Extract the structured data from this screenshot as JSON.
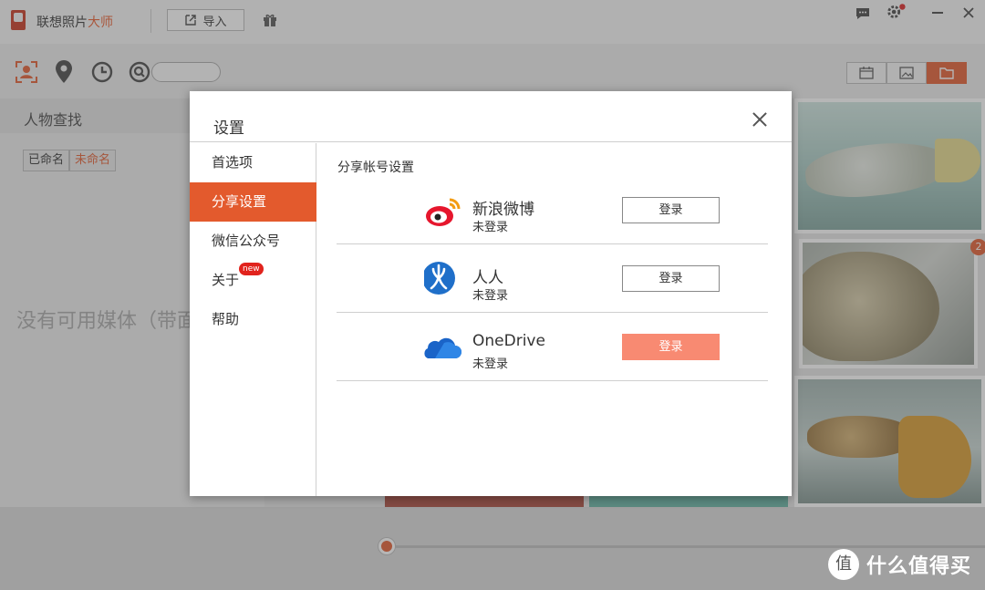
{
  "app": {
    "title_main": "联想照片",
    "title_accent": "大师",
    "import_label": "导入"
  },
  "toolbar": {
    "search_placeholder": ""
  },
  "left": {
    "people_title": "人物查找",
    "named_tab": "已命名",
    "unnamed_tab": "未命名",
    "empty_message": "没有可用媒体（带面"
  },
  "gallery": {
    "badge_count": "2"
  },
  "watermark": {
    "text": "什么值得买"
  },
  "dialog": {
    "title": "设置",
    "nav": [
      {
        "label": "首选项"
      },
      {
        "label": "分享设置"
      },
      {
        "label": "微信公众号"
      },
      {
        "label": "关于",
        "badge": "new"
      },
      {
        "label": "帮助"
      }
    ],
    "section_title": "分享帐号设置",
    "accounts": [
      {
        "name": "新浪微博",
        "status": "未登录",
        "button": "登录"
      },
      {
        "name": "人人",
        "status": "未登录",
        "button": "登录"
      },
      {
        "name": "OneDrive",
        "status": "未登录",
        "button": "登录"
      }
    ]
  },
  "colors": {
    "accent": "#e35a2d",
    "accent_light": "#f88a72"
  }
}
